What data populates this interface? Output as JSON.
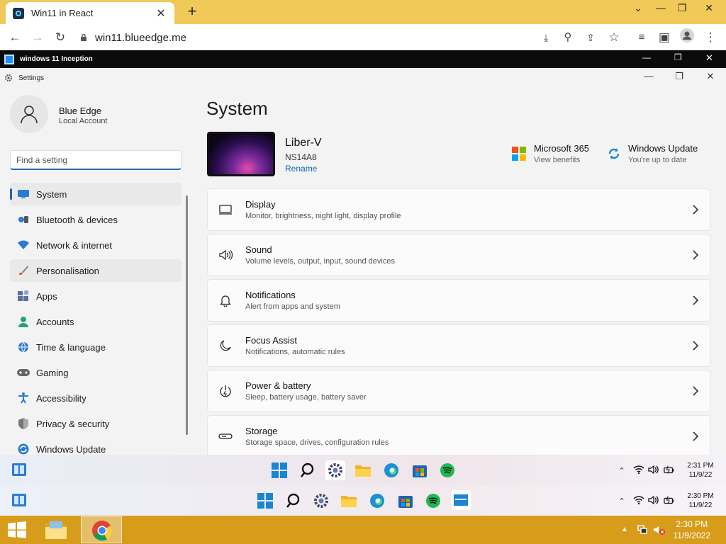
{
  "browser": {
    "tab_title": "Win11 in React",
    "url": "win11.blueedge.me"
  },
  "inception_bar": {
    "title": "windows 11 Inception"
  },
  "settings": {
    "window_title": "Settings",
    "user": {
      "name": "Blue Edge",
      "account": "Local Account"
    },
    "search_placeholder": "Find a setting",
    "nav": [
      {
        "label": "System",
        "icon": "system-icon",
        "color": "#2b7bd6"
      },
      {
        "label": "Bluetooth & devices",
        "icon": "bluetooth-icon",
        "color": "#2b7bd6"
      },
      {
        "label": "Network & internet",
        "icon": "wifi-icon",
        "color": "#2b7bd6"
      },
      {
        "label": "Personalisation",
        "icon": "brush-icon",
        "color": "#d0683a"
      },
      {
        "label": "Apps",
        "icon": "apps-icon",
        "color": "#5a6fa0"
      },
      {
        "label": "Accounts",
        "icon": "accounts-icon",
        "color": "#2aa07a"
      },
      {
        "label": "Time & language",
        "icon": "globe-icon",
        "color": "#2b7bd6"
      },
      {
        "label": "Gaming",
        "icon": "gamepad-icon",
        "color": "#666"
      },
      {
        "label": "Accessibility",
        "icon": "accessibility-icon",
        "color": "#2b7bd6"
      },
      {
        "label": "Privacy & security",
        "icon": "shield-icon",
        "color": "#777"
      },
      {
        "label": "Windows Update",
        "icon": "update-icon",
        "color": "#2b7bd6"
      }
    ],
    "page_title": "System",
    "device": {
      "name": "Liber-V",
      "model": "NS14A8",
      "rename_label": "Rename"
    },
    "quick": [
      {
        "title": "Microsoft 365",
        "subtitle": "View benefits"
      },
      {
        "title": "Windows Update",
        "subtitle": "You're up to date"
      }
    ],
    "cards": [
      {
        "title": "Display",
        "subtitle": "Monitor, brightness, night light, display profile",
        "icon": "monitor-icon"
      },
      {
        "title": "Sound",
        "subtitle": "Volume levels, output, input, sound devices",
        "icon": "speaker-icon"
      },
      {
        "title": "Notifications",
        "subtitle": "Alert from apps and system",
        "icon": "bell-icon"
      },
      {
        "title": "Focus Assist",
        "subtitle": "Notifications, automatic rules",
        "icon": "moon-icon"
      },
      {
        "title": "Power & battery",
        "subtitle": "Sleep, battery usage, battery saver",
        "icon": "power-icon"
      },
      {
        "title": "Storage",
        "subtitle": "Storage space, drives, configuration rules",
        "icon": "storage-icon"
      }
    ]
  },
  "taskbar1": {
    "time": "2:31 PM",
    "date": "11/9/22"
  },
  "taskbar2": {
    "time": "2:30 PM",
    "date": "11/9/22"
  },
  "taskbar_host": {
    "time": "2:30 PM",
    "date": "11/9/2022"
  }
}
